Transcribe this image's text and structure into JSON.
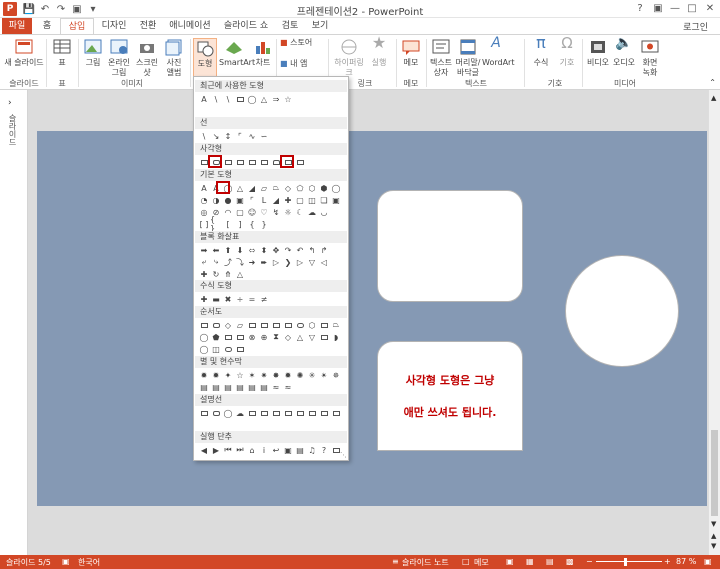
{
  "window": {
    "title": "프레젠테이션2 - PowerPoint"
  },
  "qat": {
    "icons": [
      "powerpoint-logo-icon",
      "save-icon",
      "undo-icon",
      "redo-icon",
      "start-from-beginning-icon",
      "customize-icon"
    ],
    "logo_text": "P"
  },
  "tabs": [
    {
      "label": "파일",
      "id": "file"
    },
    {
      "label": "홈",
      "id": "home"
    },
    {
      "label": "삽입",
      "id": "insert",
      "active": true
    },
    {
      "label": "디자인",
      "id": "design"
    },
    {
      "label": "전환",
      "id": "transitions"
    },
    {
      "label": "애니메이션",
      "id": "animations"
    },
    {
      "label": "슬라이드 쇼",
      "id": "slideshow"
    },
    {
      "label": "검토",
      "id": "review"
    },
    {
      "label": "보기",
      "id": "view"
    }
  ],
  "signin": "로그인",
  "ribbon": {
    "new_slide": "새 슬라이드",
    "table": "표",
    "picture": "그림",
    "online_picture": "온라인 그림",
    "screenshot": "스크린샷",
    "photo_album": "사진 앨범",
    "shapes": "도형",
    "smartart": "SmartArt",
    "chart": "차트",
    "store": "스토어",
    "my_apps": "내 앱",
    "hyperlink": "하이퍼링크",
    "action": "실행",
    "comment": "메모",
    "textbox": "텍스트 상자",
    "header_footer": "머리말/바닥글",
    "wordart": "WordArt",
    "equation": "수식",
    "symbol": "기호",
    "video": "비디오",
    "audio": "오디오",
    "screen_recording": "화면 녹화",
    "groups": {
      "slides": "슬라이드",
      "tables": "표",
      "images": "이미지",
      "links": "링크",
      "comments": "메모",
      "text": "텍스트",
      "symbols": "기호",
      "media": "미디어"
    }
  },
  "leftpane": {
    "collapsed_label": "슬라이드",
    "expand_icon": "chevron-right-icon"
  },
  "dropdown": {
    "sections": [
      "최근에 사용한 도형",
      "선",
      "사각형",
      "기본 도형",
      "블록 화살표",
      "수식 도형",
      "순서도",
      "별 및 현수막",
      "설명선",
      "실행 단추"
    ]
  },
  "slide": {
    "text_line1": "사각형 도형은 그냥",
    "text_line2": "애만 쓰셔도 됩니다.",
    "text_color": "#c00000",
    "background": "#8599b4"
  },
  "status": {
    "slide_counter": "슬라이드 5/5",
    "language": "한국어",
    "notes": "슬라이드 노트",
    "comments": "메모",
    "zoom": "87 %"
  },
  "colors": {
    "accent": "#d24726"
  }
}
